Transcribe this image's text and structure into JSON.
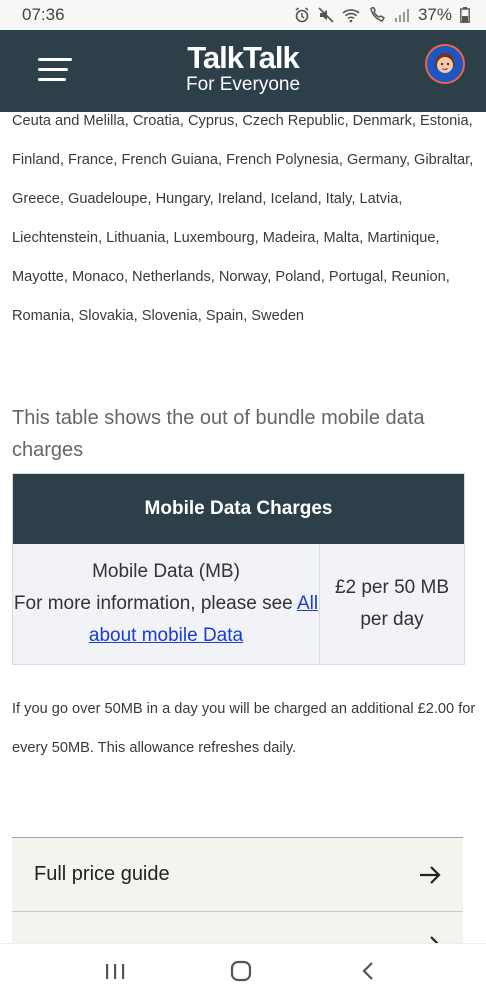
{
  "status_bar": {
    "time": "07:36",
    "battery": "37%",
    "icons": [
      "alarm-icon",
      "mute-icon",
      "wifi-icon",
      "wifi-call-icon",
      "signal-icon",
      "battery-icon"
    ]
  },
  "header": {
    "brand_name": "TalkTalk",
    "brand_tagline": "For Everyone",
    "background": "#2d3f48"
  },
  "countries_text": "Ceuta and Melilla, Croatia, Cyprus, Czech Republic, Denmark, Estonia, Finland, France, French Guiana, French Polynesia, Germany, Gibraltar, Greece, Guadeloupe, Hungary, Ireland, Iceland, Italy, Latvia, Liechtenstein, Lithuania, Luxembourg, Madeira, Malta, Martinique, Mayotte, Monaco, Netherlands, Norway, Poland, Portugal, Reunion, Romania, Slovakia, Slovenia, Spain, Sweden",
  "table_intro": "This table shows the out of bundle mobile data charges",
  "table": {
    "heading": "Mobile Data Charges",
    "row_title": "Mobile Data (MB)",
    "row_info": "For more information, please see",
    "row_link": "All about mobile Data",
    "row_price": "£2 per 50 MB per day",
    "link_color": "#1a3bd6"
  },
  "overage_text": "If you go over 50MB in a day you will be charged an additional £2.00 for every 50MB. This allowance refreshes daily.",
  "accordion": {
    "items": [
      {
        "label": "Full price guide",
        "icon": "arrow-right-icon"
      },
      {
        "label": "",
        "icon": "arrow-right-icon"
      }
    ]
  },
  "navbar": {
    "icons": [
      "recent-apps-icon",
      "home-icon",
      "back-icon"
    ]
  }
}
